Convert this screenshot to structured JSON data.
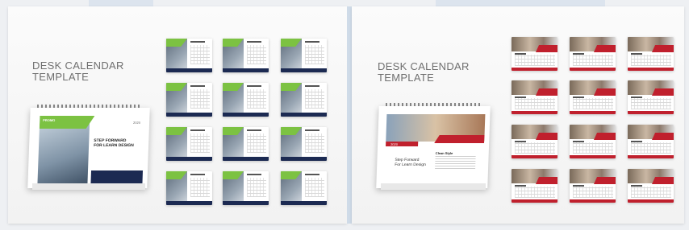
{
  "left_panel": {
    "title": "DESK CALENDAR\nTEMPLATE",
    "cover": {
      "brand": "PROMO",
      "year": "2020",
      "headline": "STEP FORWARD\nFOR LEARN DESIGN"
    },
    "accent_color": "#7cc242",
    "footer_color": "#1c2a52"
  },
  "right_panel": {
    "title": "DESK CALENDAR\nTEMPLATE",
    "cover": {
      "year": "2020",
      "headline": "Step Forward\nFor Learn Design",
      "subhead": "Clean Style"
    },
    "accent_color": "#c0202d"
  }
}
